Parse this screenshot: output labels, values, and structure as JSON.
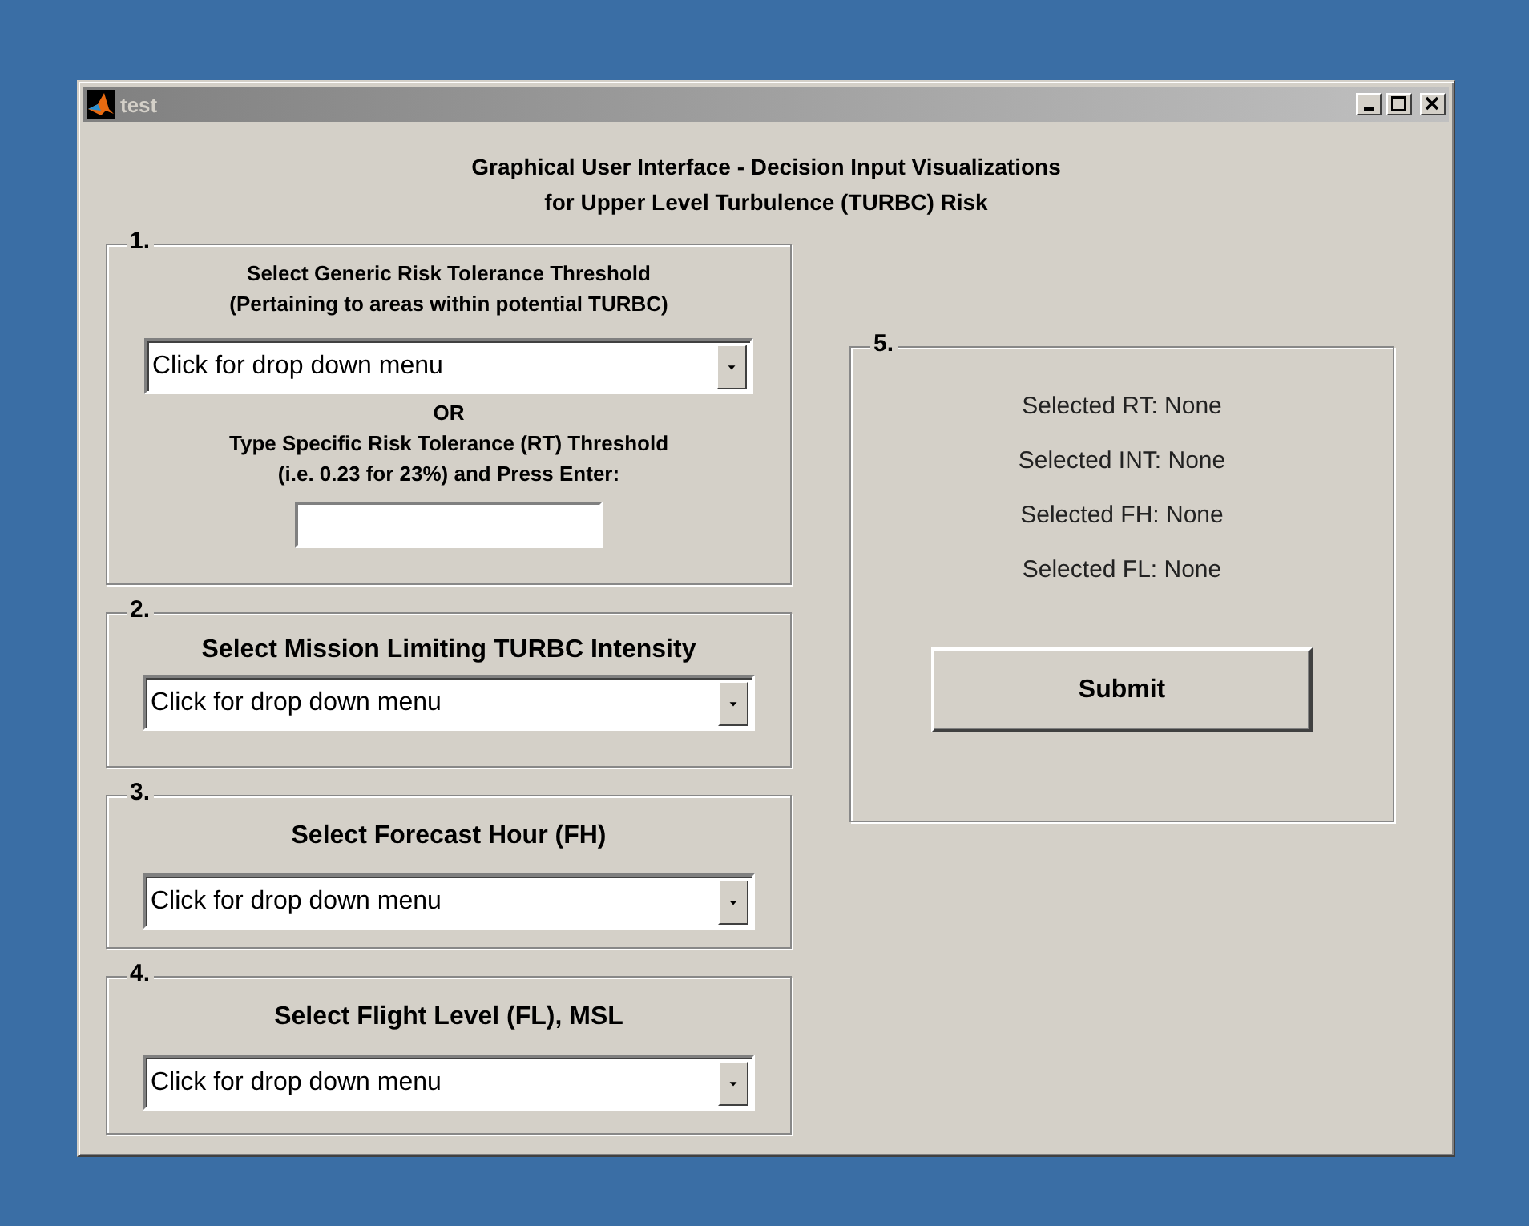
{
  "window": {
    "title": "test"
  },
  "heading": [
    "Graphical User Interface - Decision Input Visualizations",
    "for Upper Level Turbulence (TURBC) Risk"
  ],
  "panels": [
    {
      "number": "1.",
      "items": [
        {
          "kind": "label",
          "text": "Select Generic Risk Tolerance Threshold"
        },
        {
          "kind": "label",
          "text": "(Pertaining to areas within potential TURBC)"
        },
        {
          "kind": "dropdown",
          "value": "Click for drop down menu"
        },
        {
          "kind": "label",
          "text": "OR"
        },
        {
          "kind": "label",
          "text": "Type Specific Risk Tolerance (RT) Threshold"
        },
        {
          "kind": "label",
          "text": "(i.e. 0.23 for 23%) and Press Enter:"
        },
        {
          "kind": "field"
        }
      ]
    },
    {
      "number": "2.",
      "items": [
        {
          "kind": "title",
          "text": "Select Mission Limiting TURBC Intensity"
        },
        {
          "kind": "dropdown",
          "value": "Click for drop down menu"
        }
      ]
    },
    {
      "number": "3.",
      "items": [
        {
          "kind": "title",
          "text": "Select Forecast Hour (FH)"
        },
        {
          "kind": "dropdown",
          "value": "Click for drop down menu"
        }
      ]
    },
    {
      "number": "4.",
      "items": [
        {
          "kind": "title",
          "text": "Select Flight Level (FL), MSL"
        },
        {
          "kind": "dropdown",
          "value": "Click for drop down menu"
        }
      ]
    }
  ],
  "summary": {
    "number": "5.",
    "readouts": [
      {
        "label": "Selected RT:",
        "value": "None"
      },
      {
        "label": "Selected INT:",
        "value": "None"
      },
      {
        "label": "Selected FH:",
        "value": "None"
      },
      {
        "label": "Selected FL:",
        "value": "None"
      }
    ],
    "button": "Submit"
  }
}
